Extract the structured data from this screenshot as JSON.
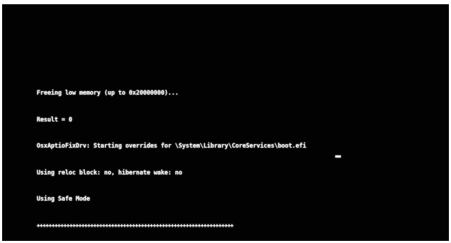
{
  "console": {
    "lines": [
      "Freeing low memory (up to 0x20000000)...",
      "Result = 0",
      "OsxAptioFixDrv: Starting overrides for \\System\\Library\\CoreServices\\boot.efi",
      "Using reloc block: no, hibernate wake: no",
      "Using Safe Mode"
    ],
    "progress_bar": "++++++++++++++++++++++++++++++++++++++++++++++++++++++++++++++++++"
  },
  "colors": {
    "screen_background": "#020202",
    "text": "#f2f2f2",
    "border": "#ffffff"
  },
  "icons": {
    "cursor": "text-cursor-underscore"
  }
}
